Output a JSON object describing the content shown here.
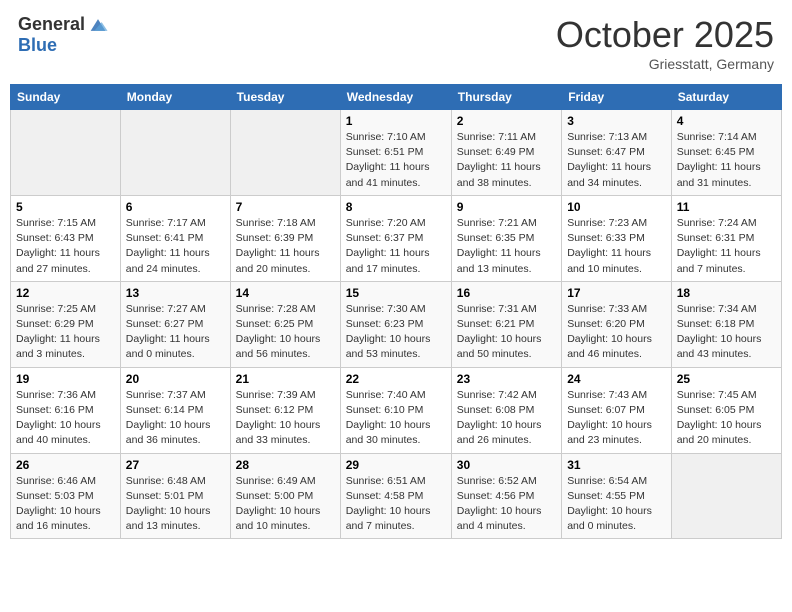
{
  "header": {
    "logo_general": "General",
    "logo_blue": "Blue",
    "month": "October 2025",
    "location": "Griesstatt, Germany"
  },
  "days_of_week": [
    "Sunday",
    "Monday",
    "Tuesday",
    "Wednesday",
    "Thursday",
    "Friday",
    "Saturday"
  ],
  "weeks": [
    [
      {
        "day": "",
        "info": ""
      },
      {
        "day": "",
        "info": ""
      },
      {
        "day": "",
        "info": ""
      },
      {
        "day": "1",
        "info": "Sunrise: 7:10 AM\nSunset: 6:51 PM\nDaylight: 11 hours and 41 minutes."
      },
      {
        "day": "2",
        "info": "Sunrise: 7:11 AM\nSunset: 6:49 PM\nDaylight: 11 hours and 38 minutes."
      },
      {
        "day": "3",
        "info": "Sunrise: 7:13 AM\nSunset: 6:47 PM\nDaylight: 11 hours and 34 minutes."
      },
      {
        "day": "4",
        "info": "Sunrise: 7:14 AM\nSunset: 6:45 PM\nDaylight: 11 hours and 31 minutes."
      }
    ],
    [
      {
        "day": "5",
        "info": "Sunrise: 7:15 AM\nSunset: 6:43 PM\nDaylight: 11 hours and 27 minutes."
      },
      {
        "day": "6",
        "info": "Sunrise: 7:17 AM\nSunset: 6:41 PM\nDaylight: 11 hours and 24 minutes."
      },
      {
        "day": "7",
        "info": "Sunrise: 7:18 AM\nSunset: 6:39 PM\nDaylight: 11 hours and 20 minutes."
      },
      {
        "day": "8",
        "info": "Sunrise: 7:20 AM\nSunset: 6:37 PM\nDaylight: 11 hours and 17 minutes."
      },
      {
        "day": "9",
        "info": "Sunrise: 7:21 AM\nSunset: 6:35 PM\nDaylight: 11 hours and 13 minutes."
      },
      {
        "day": "10",
        "info": "Sunrise: 7:23 AM\nSunset: 6:33 PM\nDaylight: 11 hours and 10 minutes."
      },
      {
        "day": "11",
        "info": "Sunrise: 7:24 AM\nSunset: 6:31 PM\nDaylight: 11 hours and 7 minutes."
      }
    ],
    [
      {
        "day": "12",
        "info": "Sunrise: 7:25 AM\nSunset: 6:29 PM\nDaylight: 11 hours and 3 minutes."
      },
      {
        "day": "13",
        "info": "Sunrise: 7:27 AM\nSunset: 6:27 PM\nDaylight: 11 hours and 0 minutes."
      },
      {
        "day": "14",
        "info": "Sunrise: 7:28 AM\nSunset: 6:25 PM\nDaylight: 10 hours and 56 minutes."
      },
      {
        "day": "15",
        "info": "Sunrise: 7:30 AM\nSunset: 6:23 PM\nDaylight: 10 hours and 53 minutes."
      },
      {
        "day": "16",
        "info": "Sunrise: 7:31 AM\nSunset: 6:21 PM\nDaylight: 10 hours and 50 minutes."
      },
      {
        "day": "17",
        "info": "Sunrise: 7:33 AM\nSunset: 6:20 PM\nDaylight: 10 hours and 46 minutes."
      },
      {
        "day": "18",
        "info": "Sunrise: 7:34 AM\nSunset: 6:18 PM\nDaylight: 10 hours and 43 minutes."
      }
    ],
    [
      {
        "day": "19",
        "info": "Sunrise: 7:36 AM\nSunset: 6:16 PM\nDaylight: 10 hours and 40 minutes."
      },
      {
        "day": "20",
        "info": "Sunrise: 7:37 AM\nSunset: 6:14 PM\nDaylight: 10 hours and 36 minutes."
      },
      {
        "day": "21",
        "info": "Sunrise: 7:39 AM\nSunset: 6:12 PM\nDaylight: 10 hours and 33 minutes."
      },
      {
        "day": "22",
        "info": "Sunrise: 7:40 AM\nSunset: 6:10 PM\nDaylight: 10 hours and 30 minutes."
      },
      {
        "day": "23",
        "info": "Sunrise: 7:42 AM\nSunset: 6:08 PM\nDaylight: 10 hours and 26 minutes."
      },
      {
        "day": "24",
        "info": "Sunrise: 7:43 AM\nSunset: 6:07 PM\nDaylight: 10 hours and 23 minutes."
      },
      {
        "day": "25",
        "info": "Sunrise: 7:45 AM\nSunset: 6:05 PM\nDaylight: 10 hours and 20 minutes."
      }
    ],
    [
      {
        "day": "26",
        "info": "Sunrise: 6:46 AM\nSunset: 5:03 PM\nDaylight: 10 hours and 16 minutes."
      },
      {
        "day": "27",
        "info": "Sunrise: 6:48 AM\nSunset: 5:01 PM\nDaylight: 10 hours and 13 minutes."
      },
      {
        "day": "28",
        "info": "Sunrise: 6:49 AM\nSunset: 5:00 PM\nDaylight: 10 hours and 10 minutes."
      },
      {
        "day": "29",
        "info": "Sunrise: 6:51 AM\nSunset: 4:58 PM\nDaylight: 10 hours and 7 minutes."
      },
      {
        "day": "30",
        "info": "Sunrise: 6:52 AM\nSunset: 4:56 PM\nDaylight: 10 hours and 4 minutes."
      },
      {
        "day": "31",
        "info": "Sunrise: 6:54 AM\nSunset: 4:55 PM\nDaylight: 10 hours and 0 minutes."
      },
      {
        "day": "",
        "info": ""
      }
    ]
  ]
}
